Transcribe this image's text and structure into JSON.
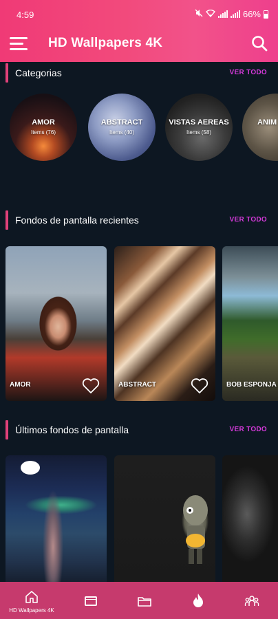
{
  "status_bar": {
    "time": "4:59",
    "battery": "66%"
  },
  "header": {
    "title": "HD Wallpapers 4K",
    "menu_icon": "hamburger-menu-icon",
    "search_icon": "search-icon"
  },
  "colors": {
    "accent": "#e0417a",
    "header_gradient_start": "#f03a76",
    "header_gradient_end": "#ee3f8c",
    "link": "#d63adb",
    "bottom_nav": "#c63a6d",
    "background": "#0d1722"
  },
  "categories_section": {
    "title": "Categorias",
    "see_all": "VER TODO",
    "items": [
      {
        "name": "AMOR",
        "count": "Items (76)"
      },
      {
        "name": "ABSTRACT",
        "count": "Items (40)"
      },
      {
        "name": "VISTAS AEREAS",
        "count": "Items (58)"
      },
      {
        "name": "ANIM",
        "count": ""
      }
    ]
  },
  "recent_section": {
    "title": "Fondos de pantalla recientes",
    "see_all": "VER TODO",
    "items": [
      {
        "label": "AMOR"
      },
      {
        "label": "ABSTRACT"
      },
      {
        "label": "BOB ESPONJA"
      }
    ]
  },
  "latest_section": {
    "title": "Últimos fondos de pantalla",
    "see_all": "VER TODO"
  },
  "bottom_nav": {
    "items": [
      {
        "label": "HD Wallpapers 4K",
        "icon": "home-icon"
      },
      {
        "label": "",
        "icon": "image-gallery-icon"
      },
      {
        "label": "",
        "icon": "folder-icon"
      },
      {
        "label": "",
        "icon": "flame-icon"
      },
      {
        "label": "",
        "icon": "people-icon"
      }
    ]
  }
}
